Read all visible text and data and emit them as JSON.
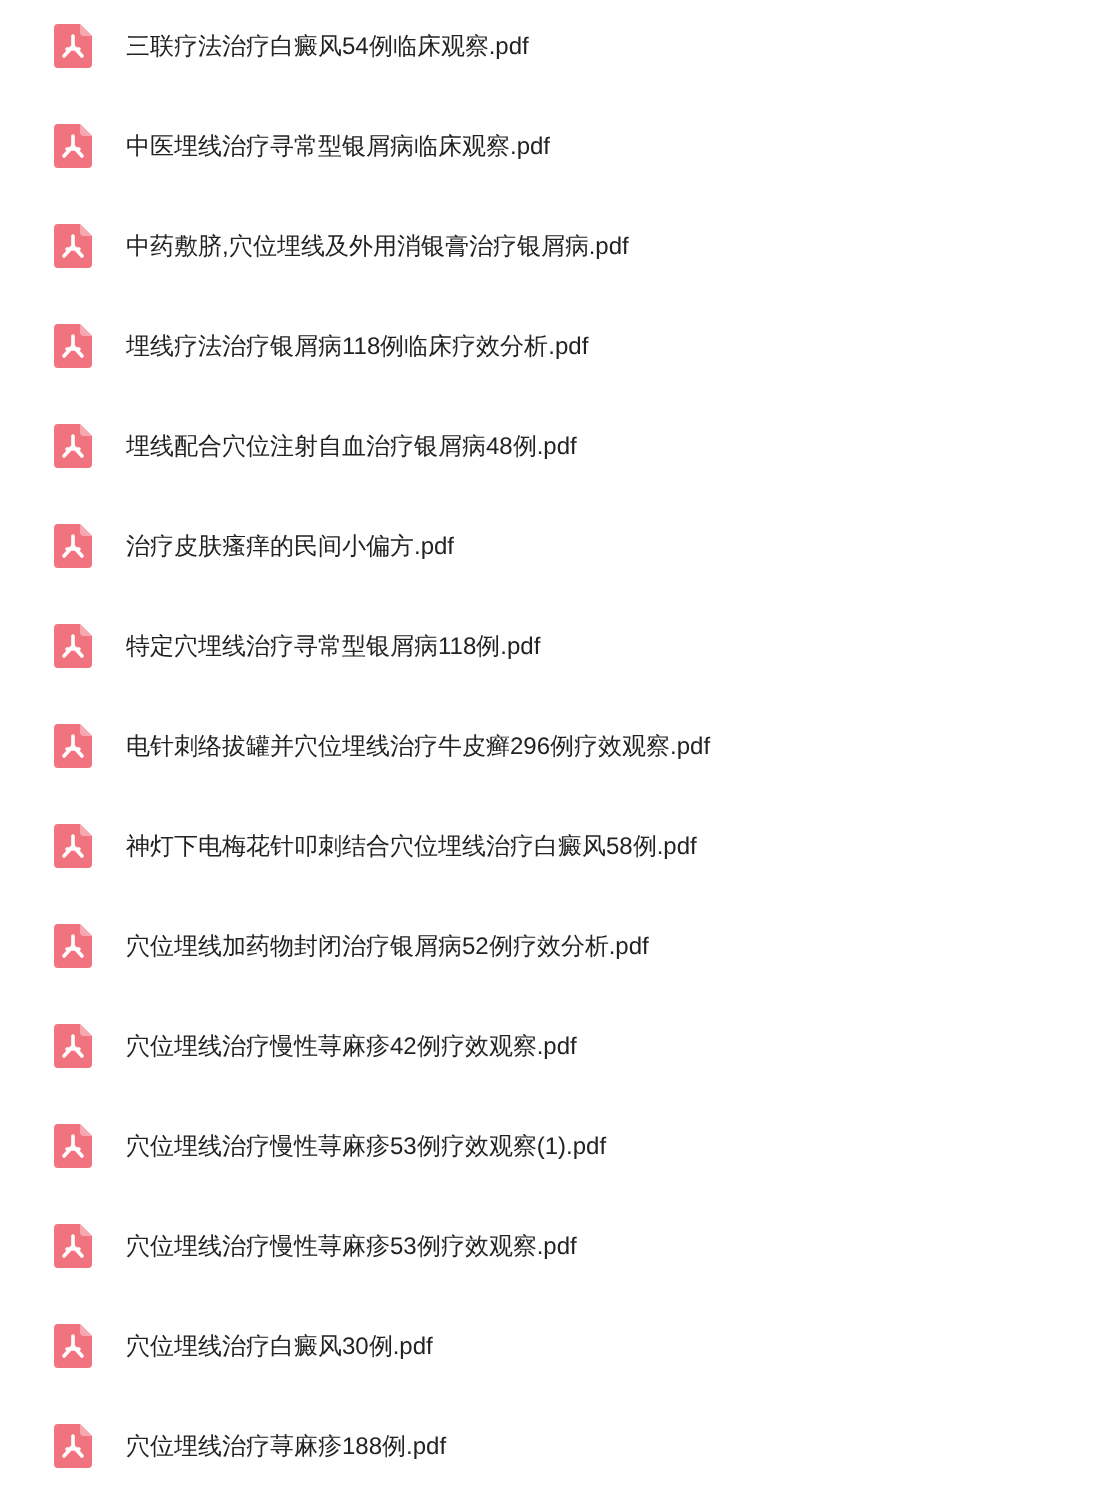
{
  "files": [
    {
      "name": "三联疗法治疗白癜风54例临床观察.pdf"
    },
    {
      "name": "中医埋线治疗寻常型银屑病临床观察.pdf"
    },
    {
      "name": "中药敷脐,穴位埋线及外用消银膏治疗银屑病.pdf"
    },
    {
      "name": "埋线疗法治疗银屑病118例临床疗效分析.pdf"
    },
    {
      "name": "埋线配合穴位注射自血治疗银屑病48例.pdf"
    },
    {
      "name": "治疗皮肤瘙痒的民间小偏方.pdf"
    },
    {
      "name": "特定穴埋线治疗寻常型银屑病118例.pdf"
    },
    {
      "name": "电针刺络拔罐并穴位埋线治疗牛皮癣296例疗效观察.pdf"
    },
    {
      "name": "神灯下电梅花针叩刺结合穴位埋线治疗白癜风58例.pdf"
    },
    {
      "name": "穴位埋线加药物封闭治疗银屑病52例疗效分析.pdf"
    },
    {
      "name": "穴位埋线治疗慢性荨麻疹42例疗效观察.pdf"
    },
    {
      "name": "穴位埋线治疗慢性荨麻疹53例疗效观察(1).pdf"
    },
    {
      "name": "穴位埋线治疗慢性荨麻疹53例疗效观察.pdf"
    },
    {
      "name": "穴位埋线治疗白癜风30例.pdf"
    },
    {
      "name": "穴位埋线治疗荨麻疹188例.pdf"
    }
  ]
}
